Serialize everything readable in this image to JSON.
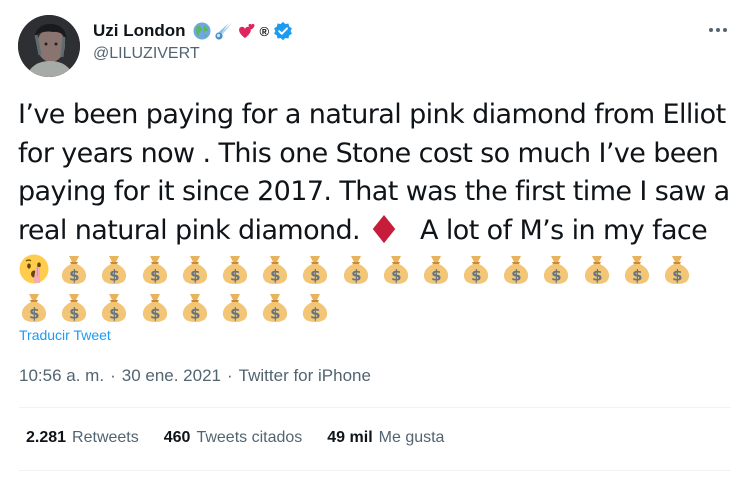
{
  "author": {
    "display_name": "Uzi London",
    "handle": "@LILUZIVERT",
    "registered_mark": "®"
  },
  "tweet": {
    "text_lines": [
      "I’ve been paying for a natural pink diamond from Elliot",
      "for years now . This one Stone cost so much I’ve been",
      "paying for it since 2017. That was the first time I saw a",
      "real natural pink diamond."
    ],
    "text_after_diamond": "A lot of M’s in my face",
    "emoji_row1_moneybags": 16,
    "emoji_row2_moneybags": 8
  },
  "translate_label": "Traducir Tweet",
  "meta": {
    "time": "10:56 a. m.",
    "separator": "·",
    "date": "30 ene. 2021",
    "source": "Twitter for iPhone"
  },
  "stats": {
    "retweets_count": "2.281",
    "retweets_label": "Retweets",
    "quotes_count": "460",
    "quotes_label": "Tweets citados",
    "likes_count": "49 mil",
    "likes_label": "Me gusta"
  },
  "colors": {
    "text": "#0f1419",
    "secondary": "#536471",
    "link": "#1d9bf0",
    "verified": "#1d9bf0",
    "diamond": "#c81d3a",
    "money_bag": "#f3c677"
  },
  "icons": [
    "globe-icon",
    "comet-icon",
    "two-hearts-icon",
    "verified-badge-icon",
    "more-icon",
    "diamond-suit-icon",
    "shushing-face-icon",
    "money-bag-icon"
  ]
}
